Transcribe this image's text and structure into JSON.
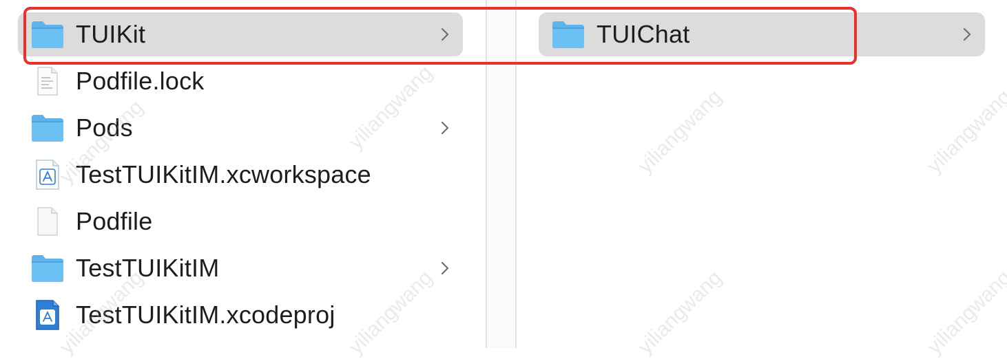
{
  "columns": [
    {
      "items": [
        {
          "name": "TUIKit",
          "icon": "folder-icon",
          "has_children": true,
          "selected": true
        },
        {
          "name": "Podfile.lock",
          "icon": "text-file-icon",
          "has_children": false
        },
        {
          "name": "Pods",
          "icon": "folder-icon",
          "has_children": true
        },
        {
          "name": "TestTUIKitIM.xcworkspace",
          "icon": "xcworkspace-icon",
          "has_children": false
        },
        {
          "name": "Podfile",
          "icon": "blank-file-icon",
          "has_children": false
        },
        {
          "name": "TestTUIKitIM",
          "icon": "folder-icon",
          "has_children": true
        },
        {
          "name": "TestTUIKitIM.xcodeproj",
          "icon": "xcodeproj-icon",
          "has_children": false
        }
      ]
    },
    {
      "items": [
        {
          "name": "TUIChat",
          "icon": "folder-icon",
          "has_children": true,
          "selected": true
        }
      ]
    }
  ],
  "watermark": {
    "text": "yiliangwang"
  },
  "colors": {
    "selection": "#dcdcdc",
    "folder": "#5eb3ec",
    "highlight_border": "#e8302c",
    "text": "#1d1d1f"
  }
}
